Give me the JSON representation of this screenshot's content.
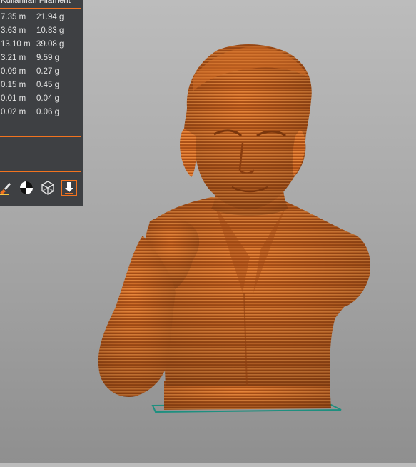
{
  "filament_panel": {
    "header_text": "Kullanılan Filament",
    "rows": [
      {
        "length": "7.35 m",
        "weight": "21.94 g"
      },
      {
        "length": "3.63 m",
        "weight": "10.83 g"
      },
      {
        "length": "13.10 m",
        "weight": "39.08 g"
      },
      {
        "length": "3.21 m",
        "weight": "9.59 g"
      },
      {
        "length": "0.09 m",
        "weight": "0.27 g"
      },
      {
        "length": "0.15 m",
        "weight": "0.45 g"
      },
      {
        "length": "0.01 m",
        "weight": "0.04 g"
      },
      {
        "length": "0.02 m",
        "weight": "0.06 g"
      }
    ]
  },
  "toolbar": {
    "icons": [
      "paint-brush-icon",
      "orientation-circle-icon",
      "wireframe-cube-icon",
      "export-arrow-icon"
    ]
  },
  "colors": {
    "model_orange": "#c8631f",
    "accent_orange": "#f2731f",
    "panel_bg": "#3e4043",
    "bed_outline": "#1e8f7f"
  }
}
